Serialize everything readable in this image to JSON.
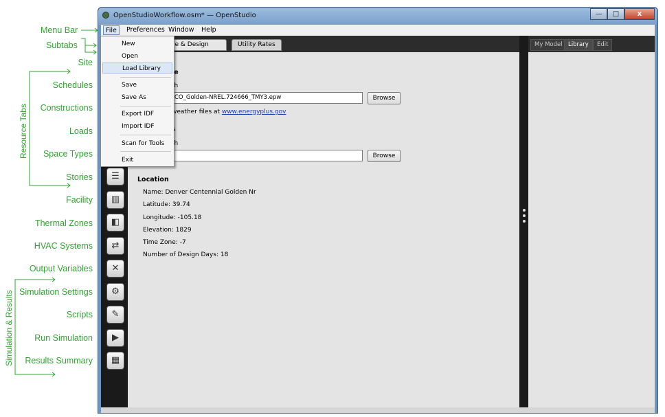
{
  "window": {
    "title": "OpenStudioWorkflow.osm* — OpenStudio",
    "controls": {
      "minimize": "—",
      "maximize": "□",
      "close": "x"
    }
  },
  "menubar": {
    "items": [
      "File",
      "Preferences",
      "Window",
      "Help"
    ]
  },
  "file_menu": {
    "items": [
      "New",
      "Open",
      "Load Library",
      "Save",
      "Save As",
      "Export IDF",
      "Import IDF",
      "Scan for Tools",
      "Exit"
    ],
    "highlighted": "Load Library"
  },
  "subtabs": [
    "Weather File & Design Days",
    "Utility Rates"
  ],
  "visible_subtab_text": "le & Design Days",
  "weather": {
    "section_title_fragment": "le",
    "path_label_fragment": "th",
    "path_value_fragment": "CO_Golden-NREL.724666_TMY3.epw",
    "browse_label": "Browse",
    "download_text_fragment": "weather files at",
    "download_link": "www.energyplus.gov"
  },
  "design_days": {
    "section_title_fragment": "s",
    "path_label_fragment": "th",
    "browse_label": "Browse"
  },
  "location": {
    "title": "Location",
    "name": "Name: Denver Centennial  Golden   Nr",
    "latitude": "Latitude: 39.74",
    "longitude": "Longitude: -105.18",
    "elevation": "Elevation: 1829",
    "time_zone": "Time Zone: -7",
    "design_days_count": "Number of Design Days: 18"
  },
  "right_panel": {
    "tabs": [
      "My Model",
      "Library",
      "Edit"
    ]
  },
  "annotations": {
    "menu_bar": "Menu Bar",
    "subtabs": "Subtabs",
    "site": "Site",
    "schedules": "Schedules",
    "constructions": "Constructions",
    "loads": "Loads",
    "space_types": "Space Types",
    "stories": "Stories",
    "facility": "Facility",
    "thermal_zones": "Thermal Zones",
    "hvac_systems": "HVAC Systems",
    "output_variables": "Output Variables",
    "simulation_settings": "Simulation Settings",
    "scripts": "Scripts",
    "run_simulation": "Run Simulation",
    "results_summary": "Results Summary",
    "resource_tabs": "Resource Tabs",
    "simulation_results": "Simulation & Results"
  },
  "colors": {
    "annotation_green": "#33a433",
    "title_bar": "#7aa0cb",
    "dark_chrome": "#1a1a1a",
    "content_bg": "#e4e4e4"
  },
  "icons": [
    "stories-icon",
    "facility-icon",
    "thermal-zones-icon",
    "hvac-icon",
    "output-variables-icon",
    "simulation-settings-icon",
    "scripts-icon",
    "run-simulation-icon",
    "results-summary-icon"
  ]
}
